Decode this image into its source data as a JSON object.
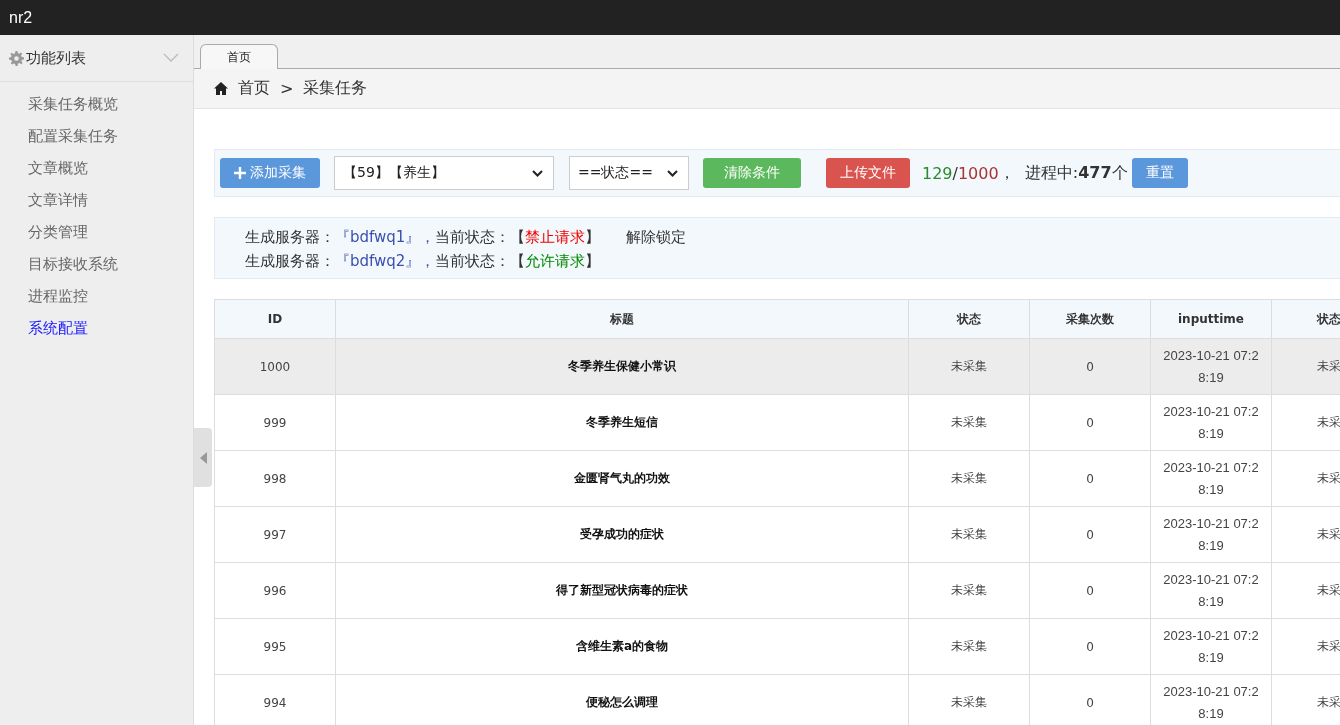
{
  "window": {
    "title": "nr2"
  },
  "sidebar": {
    "title": "功能列表",
    "items": [
      {
        "label": "采集任务概览",
        "selected": false
      },
      {
        "label": "配置采集任务",
        "selected": false
      },
      {
        "label": "文章概览",
        "selected": false
      },
      {
        "label": "文章详情",
        "selected": false
      },
      {
        "label": "分类管理",
        "selected": false
      },
      {
        "label": "目标接收系统",
        "selected": false
      },
      {
        "label": "进程监控",
        "selected": false
      },
      {
        "label": "系统配置",
        "selected": true
      }
    ]
  },
  "tabs": [
    {
      "label": "首页",
      "selected": true
    }
  ],
  "breadcrumb": [
    "首页",
    ">",
    "采集任务"
  ],
  "toolbar": {
    "add_button": "添加采集",
    "category_select": "【59】【养生】",
    "status_select": "==状态==",
    "clear_button": "清除条件",
    "upload_button": "上传文件",
    "done": "129",
    "slash": "/",
    "total": "1000",
    "progress": "，  进程中:**477**个",
    "reset_button": "重置"
  },
  "servers": [
    {
      "label": "生成服务器：",
      "name": "『bdfwq1』，",
      "status_label": "当前状态：【",
      "status": "禁止请求",
      "close": "】",
      "allowed": false,
      "action": "解除锁定"
    },
    {
      "label": "生成服务器：",
      "name": "『bdfwq2』，",
      "status_label": "当前状态：【",
      "status": "允许请求",
      "close": "】",
      "allowed": true
    }
  ],
  "table": {
    "columns": [
      "ID",
      "标题",
      "状态",
      "采集次数",
      "inputtime",
      "状态"
    ],
    "rows": [
      {
        "highlighted": true,
        "cells": [
          "1000",
          "冬季养生保健小常识",
          "未采集",
          "0",
          "2023-10-21 07:28:19",
          "未采"
        ]
      },
      {
        "highlighted": false,
        "cells": [
          "999",
          "冬季养生短信",
          "未采集",
          "0",
          "2023-10-21 07:28:19",
          "未采"
        ]
      },
      {
        "highlighted": false,
        "cells": [
          "998",
          "金匮肾气丸的功效",
          "未采集",
          "0",
          "2023-10-21 07:28:19",
          "未采"
        ]
      },
      {
        "highlighted": false,
        "cells": [
          "997",
          "受孕成功的症状",
          "未采集",
          "0",
          "2023-10-21 07:28:19",
          "未采"
        ]
      },
      {
        "highlighted": false,
        "cells": [
          "996",
          "得了新型冠状病毒的症状",
          "未采集",
          "0",
          "2023-10-21 07:28:19",
          "未采"
        ]
      },
      {
        "highlighted": false,
        "cells": [
          "995",
          "含维生素a的食物",
          "未采集",
          "0",
          "2023-10-21 07:28:19",
          "未采"
        ]
      },
      {
        "highlighted": false,
        "cells": [
          "994",
          "便秘怎么调理",
          "未采集",
          "0",
          "2023-10-21 07:28:19",
          "未采"
        ]
      }
    ]
  }
}
